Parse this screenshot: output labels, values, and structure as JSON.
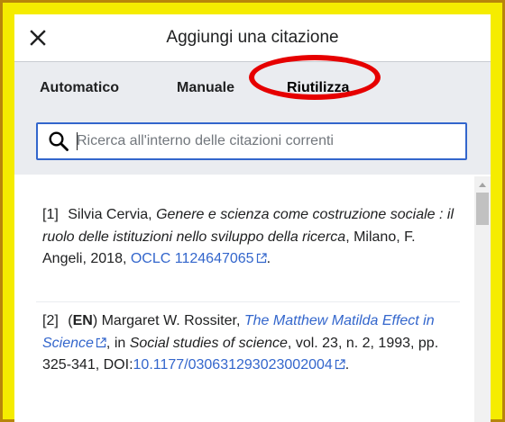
{
  "dialog": {
    "title": "Aggiungi una citazione",
    "close_icon": "close-icon"
  },
  "tabs": [
    {
      "label": "Automatico"
    },
    {
      "label": "Manuale"
    },
    {
      "label": "Riutilizza",
      "selected": true
    }
  ],
  "highlight_color": "#e60000",
  "search": {
    "placeholder": "Ricerca all'interno delle citazioni correnti",
    "value": "",
    "icon": "search-icon"
  },
  "citations": [
    {
      "number": "[1]",
      "author": "Silvia Cervia,",
      "title": "Genere e scienza come costruzione sociale : il ruolo delle istituzioni nello sviluppo della ricerca",
      "publisher": ", Milano, F. Angeli, 2018,",
      "id_label": "OCLC 1124647065",
      "end": "."
    },
    {
      "number": "[2]",
      "lang_open": "(",
      "lang": "EN",
      "lang_close": ")",
      "author": "Margaret W. Rossiter,",
      "title_link": "The Matthew Matilda Effect in Science",
      "mid": ", in",
      "journal": "Social studies of science",
      "details": ", vol. 23, n. 2, 1993, pp. 325-341,",
      "doi_label": "DOI:",
      "doi": "10.1177/030631293023002004",
      "end": "."
    }
  ],
  "colors": {
    "accent": "#3366cc",
    "tab_bar": "#eaecf0",
    "frame_yellow": "#f5ec00",
    "outer_border": "#b8860b"
  }
}
